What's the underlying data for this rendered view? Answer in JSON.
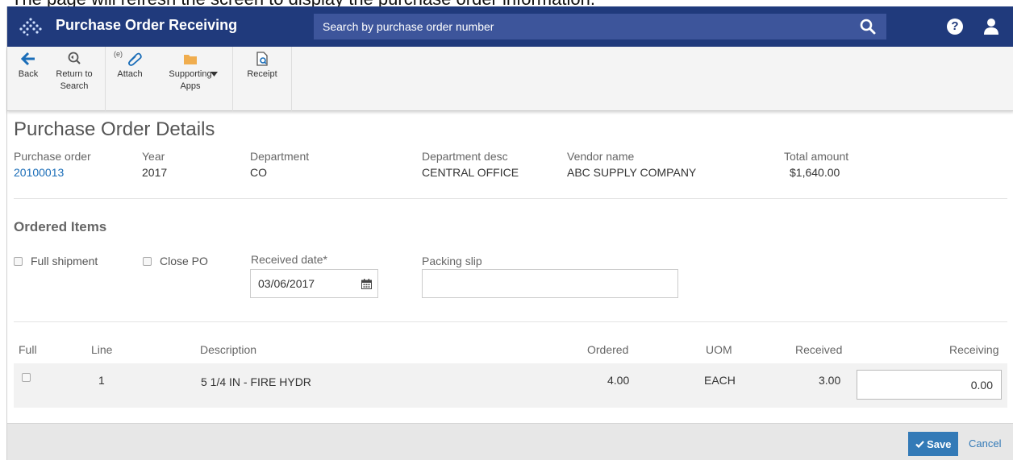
{
  "caption": "The page will refresh the screen to display the purchase order information.",
  "header": {
    "title": "Purchase Order Receiving",
    "search_placeholder": "Search by purchase order number",
    "help_icon": "?",
    "brand_color": "#203a7c"
  },
  "toolbar": {
    "back": "Back",
    "return_to_search": "Return to Search",
    "attach_prefix": "(e)",
    "attach": "Attach",
    "supporting_apps": "Supporting Apps",
    "receipt": "Receipt"
  },
  "details": {
    "title": "Purchase Order Details",
    "fields": [
      {
        "label": "Purchase order",
        "value": "20100013"
      },
      {
        "label": "Year",
        "value": "2017"
      },
      {
        "label": "Department",
        "value": "CO"
      },
      {
        "label": "Department desc",
        "value": "CENTRAL OFFICE"
      },
      {
        "label": "Vendor name",
        "value": "ABC SUPPLY COMPANY"
      },
      {
        "label": "Total amount",
        "value": "$1,640.00"
      }
    ]
  },
  "ordered_items": {
    "title": "Ordered Items",
    "full_shipment": "Full shipment",
    "close_po": "Close PO",
    "received_date_label": "Received date*",
    "received_date_value": "03/06/2017",
    "packing_slip_label": "Packing slip",
    "packing_slip_value": ""
  },
  "table": {
    "headers": {
      "full": "Full",
      "line": "Line",
      "description": "Description",
      "ordered": "Ordered",
      "uom": "UOM",
      "received": "Received",
      "receiving": "Receiving"
    },
    "rows": [
      {
        "line": "1",
        "description": "5 1/4 IN - FIRE HYDR",
        "ordered": "4.00",
        "uom": "EACH",
        "received": "3.00",
        "receiving": "0.00"
      }
    ]
  },
  "footer": {
    "save": "Save",
    "cancel": "Cancel"
  }
}
